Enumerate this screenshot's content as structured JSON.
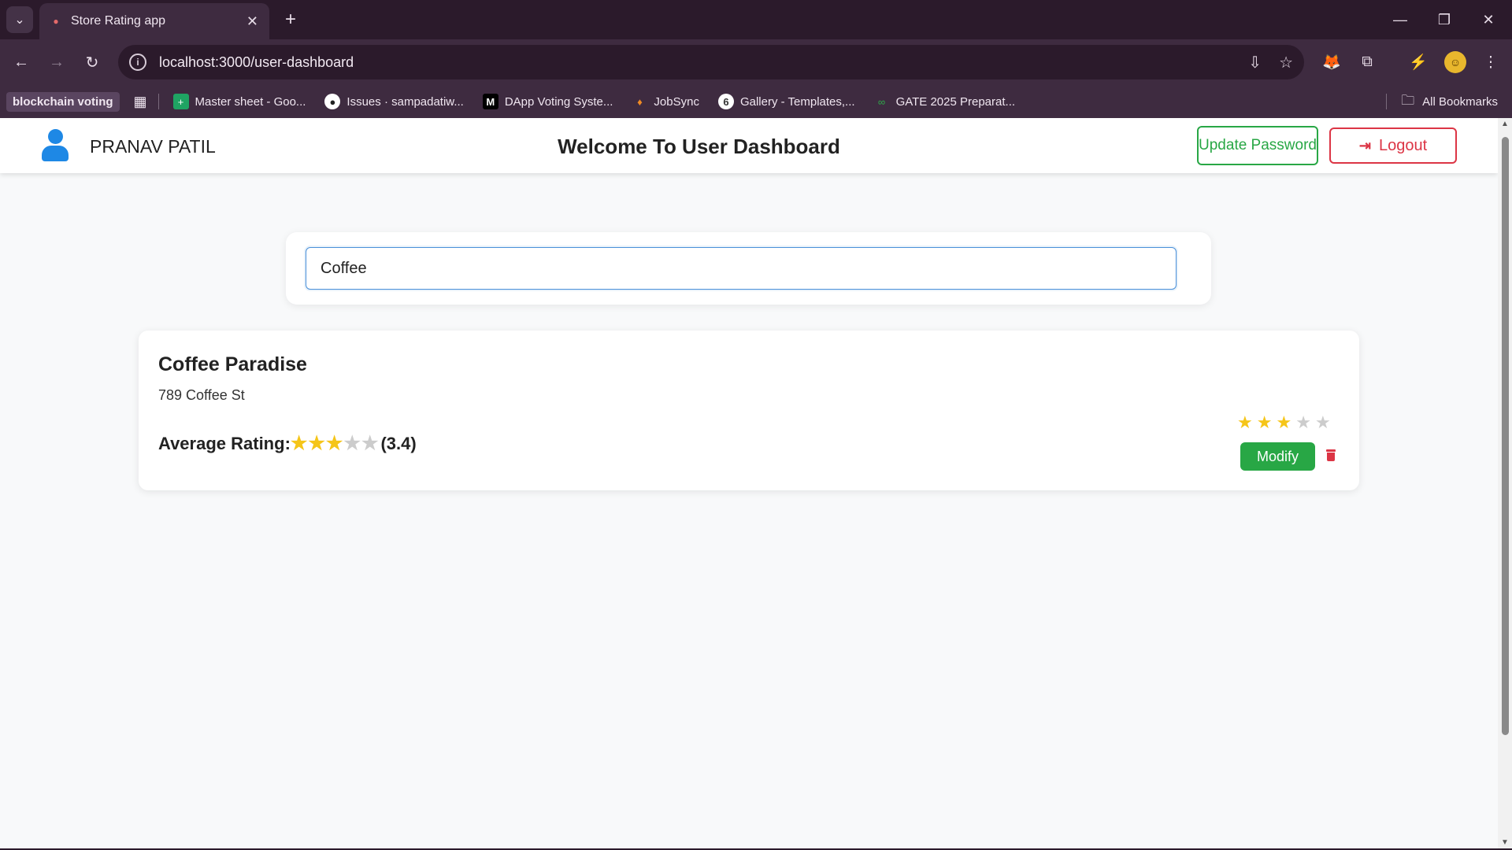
{
  "browser": {
    "tab_title": "Store Rating app",
    "url": "localhost:3000/user-dashboard",
    "bookmarks": [
      {
        "label": "blockchain voting",
        "icon": "folder"
      },
      {
        "label": "Master sheet - Goo...",
        "icon": "sheets-icon"
      },
      {
        "label": "Issues · sampadatiw...",
        "icon": "github-icon"
      },
      {
        "label": "DApp Voting Syste...",
        "icon": "medium-icon"
      },
      {
        "label": "JobSync",
        "icon": "jobsync-icon"
      },
      {
        "label": "Gallery - Templates,...",
        "icon": "gallery-icon"
      },
      {
        "label": "GATE 2025 Preparat...",
        "icon": "gate-icon"
      }
    ],
    "all_bookmarks": "All Bookmarks"
  },
  "header": {
    "username": "PRANAV PATIL",
    "title": "Welcome To User Dashboard",
    "update_password": "Update Password",
    "logout": "Logout"
  },
  "search": {
    "value": "Coffee"
  },
  "store": {
    "name": "Coffee Paradise",
    "address": "789 Coffee St",
    "average_label": "Average Rating:",
    "average_value": "(3.4)",
    "average_stars_filled": 3,
    "user_rating_stars_filled": 3,
    "total_stars": 5,
    "modify_label": "Modify"
  },
  "colors": {
    "accent_blue": "#1e88e5",
    "success_green": "#28a745",
    "danger_red": "#dc3545",
    "star_gold": "#f5c518"
  }
}
